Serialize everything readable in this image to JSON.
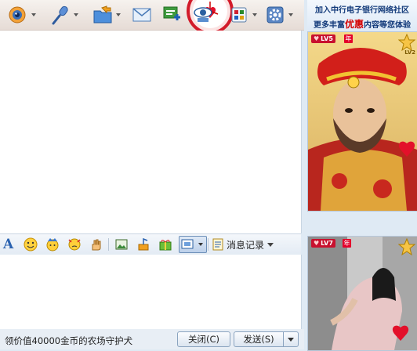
{
  "toolbar": {
    "buttons": [
      {
        "name": "video-call",
        "icon": "webcam-icon",
        "has_dropdown": true
      },
      {
        "name": "voice-call",
        "icon": "microphone-icon",
        "has_dropdown": true
      },
      {
        "name": "send-file",
        "icon": "folder-send-icon",
        "has_dropdown": true
      },
      {
        "name": "send-mail",
        "icon": "email-icon",
        "has_dropdown": false
      },
      {
        "name": "create-group",
        "icon": "add-group-icon",
        "has_dropdown": false
      },
      {
        "name": "remote-assist",
        "icon": "monitor-eye-icon",
        "has_dropdown": false
      },
      {
        "name": "apps",
        "icon": "apps-icon",
        "has_dropdown": true
      },
      {
        "name": "settings",
        "icon": "gear-icon",
        "has_dropdown": true
      }
    ]
  },
  "format_toolbar": {
    "font_label": "A",
    "history_label": "消息记录"
  },
  "bottom_bar": {
    "status_text": "领价值40000金币的农场守护犬",
    "close_label": "关闭(C)",
    "send_label": "发送(S)"
  },
  "sidebar": {
    "ad": {
      "line1": "加入中行电子银行网络社区",
      "line2_prefix": "更多丰富",
      "line2_highlight": "优惠",
      "line2_suffix": "内容等您体验"
    },
    "top_show": {
      "level": "LV5",
      "year_badge": "年",
      "star_level": "LV2"
    },
    "bottom_show": {
      "level": "LV7",
      "year_badge": "年"
    }
  },
  "colors": {
    "accent_red": "#c8102e",
    "toolbar_bg": "#ece4df",
    "window_bg": "#dfeaf4"
  }
}
